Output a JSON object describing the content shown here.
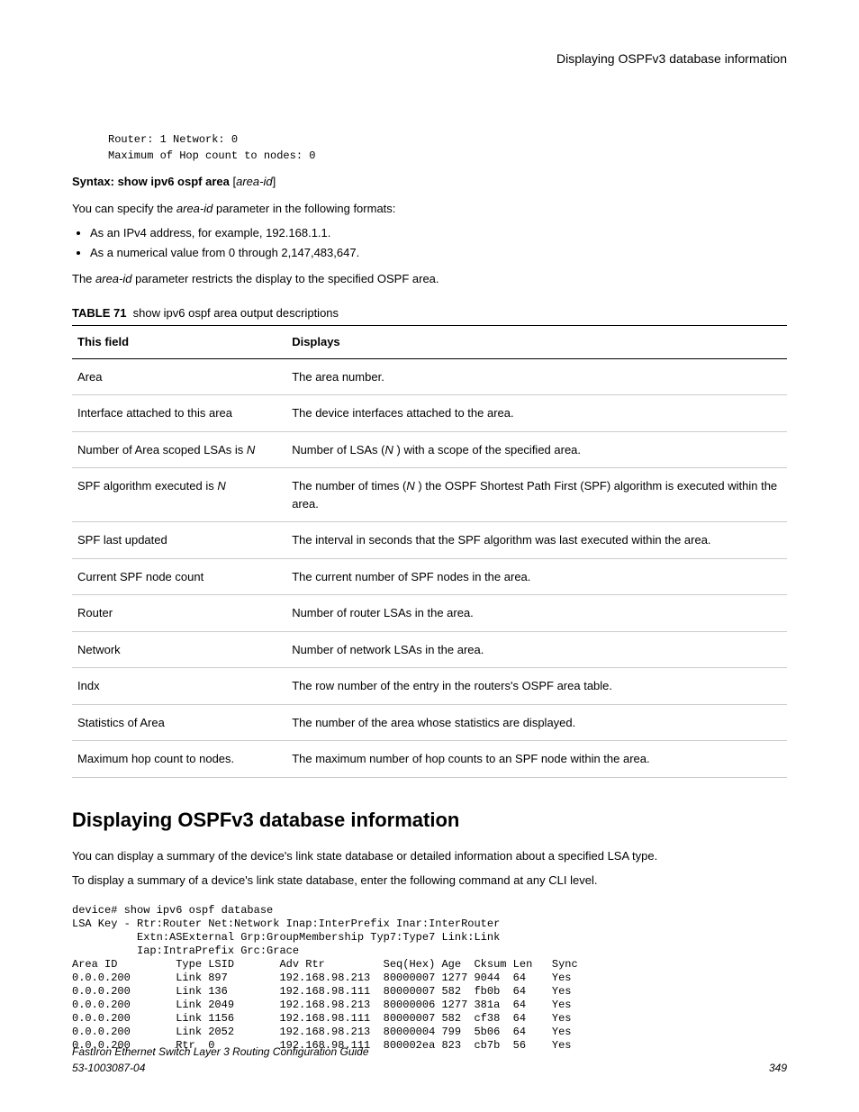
{
  "header": {
    "title": "Displaying OSPFv3 database information"
  },
  "code1": "Router: 1 Network: 0\nMaximum of Hop count to nodes: 0",
  "syntax": {
    "prefix": "Syntax: show ipv6 ospf area",
    "arg_open": "[",
    "arg": "area-id",
    "arg_close": "]"
  },
  "para1_a": "You can specify the ",
  "para1_var": "area-id",
  "para1_b": " parameter in the following formats:",
  "bullets": [
    "As an IPv4 address, for example, 192.168.1.1.",
    "As a numerical value from 0 through 2,147,483,647."
  ],
  "para2_a": "The ",
  "para2_var": "area-id",
  "para2_b": " parameter restricts the display to the specified OSPF area.",
  "table": {
    "label": "TABLE 71",
    "caption": "show ipv6 ospf area output descriptions",
    "head": {
      "c1": "This field",
      "c2": "Displays"
    },
    "rows": [
      {
        "f": "Area",
        "d": "The area number."
      },
      {
        "f": "Interface attached to this area",
        "d": "The device interfaces attached to the area."
      },
      {
        "f_html": "Number of Area scoped LSAs is <em class='var'>N</em>",
        "d_html": "Number of LSAs (<em class='var'>N</em> ) with a scope of the specified area."
      },
      {
        "f_html": "SPF algorithm executed is <em class='var'>N</em>",
        "d_html": "The number of times (<em class='var'>N</em> ) the OSPF Shortest Path First (SPF) algorithm is executed within the area."
      },
      {
        "f": "SPF last updated",
        "d": "The interval in seconds that the SPF algorithm was last executed within the area."
      },
      {
        "f": "Current SPF node count",
        "d": "The current number of SPF nodes in the area."
      },
      {
        "f": "Router",
        "d": "Number of router LSAs in the area."
      },
      {
        "f": "Network",
        "d": "Number of network LSAs in the area."
      },
      {
        "f": "Indx",
        "d": "The row number of the entry in the routers's OSPF area table."
      },
      {
        "f": "Statistics of Area",
        "d": "The number of the area whose statistics are displayed."
      },
      {
        "f": "Maximum hop count to nodes.",
        "d": "The maximum number of hop counts to an SPF node within the area."
      }
    ]
  },
  "section_title": "Displaying OSPFv3 database information",
  "para3": "You can display a summary of the device's link state database or detailed information about a specified LSA type.",
  "para4": "To display a summary of a device's link state database, enter the following command at any CLI level.",
  "cli": "device# show ipv6 ospf database\nLSA Key - Rtr:Router Net:Network Inap:InterPrefix Inar:InterRouter\n          Extn:ASExternal Grp:GroupMembership Typ7:Type7 Link:Link\n          Iap:IntraPrefix Grc:Grace\nArea ID         Type LSID       Adv Rtr         Seq(Hex) Age  Cksum Len   Sync\n0.0.0.200       Link 897        192.168.98.213  80000007 1277 9044  64    Yes\n0.0.0.200       Link 136        192.168.98.111  80000007 582  fb0b  64    Yes\n0.0.0.200       Link 2049       192.168.98.213  80000006 1277 381a  64    Yes\n0.0.0.200       Link 1156       192.168.98.111  80000007 582  cf38  64    Yes\n0.0.0.200       Link 2052       192.168.98.213  80000004 799  5b06  64    Yes\n0.0.0.200       Rtr  0          192.168.98.111  800002ea 823  cb7b  56    Yes",
  "footer": {
    "doc": "FastIron Ethernet Switch Layer 3 Routing Configuration Guide",
    "num": "53-1003087-04",
    "page": "349"
  }
}
